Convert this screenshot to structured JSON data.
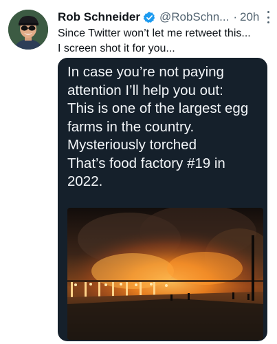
{
  "tweet": {
    "author_name": "Rob Schneider",
    "handle": "@RobSchn...",
    "separator": "·",
    "time": "20h",
    "text_lines": [
      "Since Twitter won’t let me retweet this...",
      "I screen shot it for you..."
    ]
  },
  "card": {
    "lines": [
      "In case you’re not paying",
      "attention I’ll help you out:",
      "This is one of the largest egg",
      "farms in the country.",
      "Mysteriously torched",
      "That’s food factory #19 in",
      "2022."
    ]
  },
  "icons": {
    "verified": "verified-badge-icon",
    "more": "more-options-icon"
  },
  "colors": {
    "verified_blue": "#1d9bf0",
    "secondary_text": "#536471",
    "card_bg": "#15202b",
    "card_text": "#f2f5f8",
    "fire": "#ff8a1f"
  }
}
